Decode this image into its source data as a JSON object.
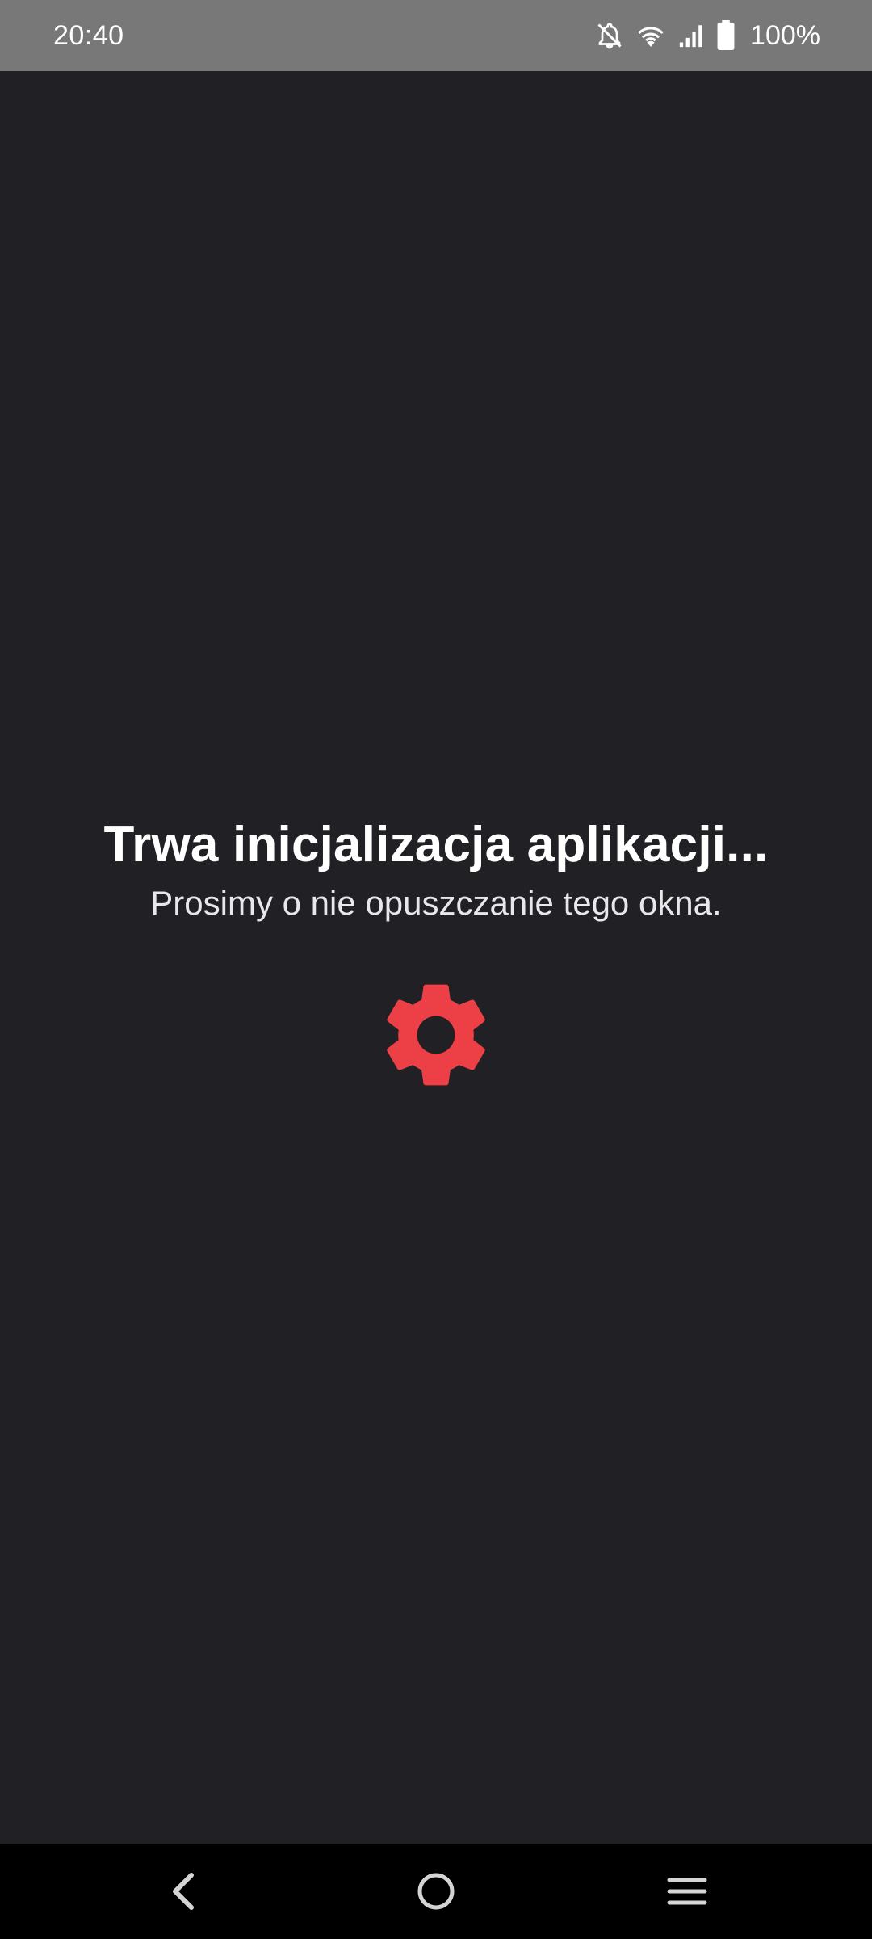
{
  "status_bar": {
    "time": "20:40",
    "battery_text": "100%",
    "icons": [
      "notifications-off-icon",
      "wifi-icon",
      "cell-signal-icon",
      "battery-icon"
    ]
  },
  "main": {
    "title": "Trwa inicjalizacja aplikacji...",
    "subtitle": "Prosimy o nie opuszczanie tego okna.",
    "icon": "gear-icon",
    "accent_color": "#ec4046",
    "background_color": "#202025"
  },
  "nav_bar": {
    "buttons": [
      "back-icon",
      "home-icon",
      "recents-icon"
    ]
  }
}
